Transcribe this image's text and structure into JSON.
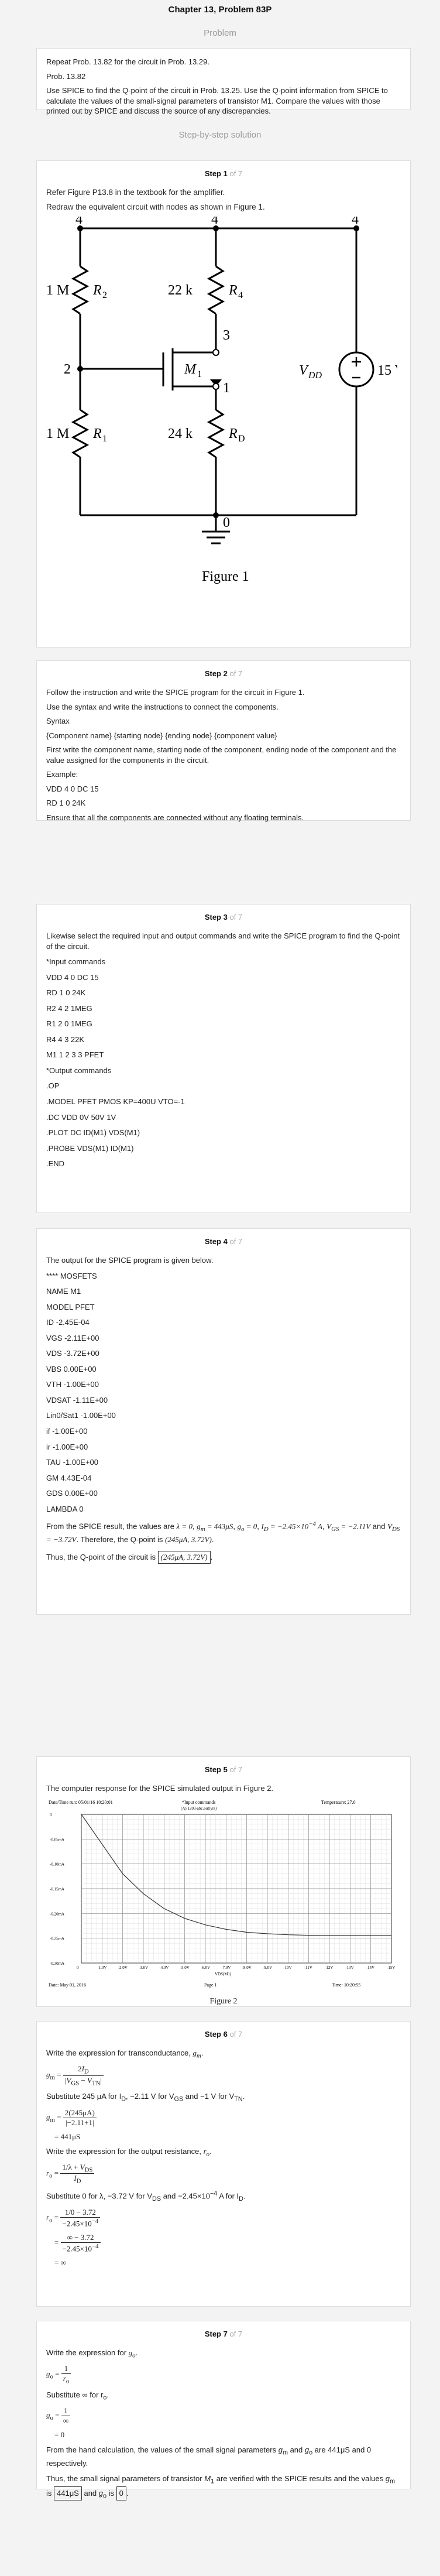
{
  "header": {
    "title": "Chapter 13, Problem 83P",
    "problem_label": "Problem",
    "solution_label": "Step-by-step solution"
  },
  "problem": {
    "lines": [
      "Repeat Prob. 13.82 for the circuit in Prob. 13.29.",
      "Prob. 13.82",
      "Use SPICE to find the Q-point of the circuit in Prob. 13.25. Use the Q-point information from SPICE to calculate the values of the small-signal parameters of transistor M1. Compare the values with those printed out by SPICE and discuss the source of any discrepancies."
    ]
  },
  "steps": {
    "s1": {
      "label": "Step 1",
      "of": "of 7",
      "lines": [
        "Refer Figure P13.8 in the textbook for the amplifier.",
        "Redraw the equivalent circuit with nodes as shown in Figure 1."
      ],
      "figure_caption": "Figure 1",
      "circuit": {
        "n4a": "4",
        "n4b": "4",
        "n4c": "4",
        "n2": "2",
        "n3": "3",
        "n1": "1",
        "n0": "0",
        "r2": "1 M",
        "r2n": "R",
        "r2s": "2",
        "r4": "22 k",
        "r4n": "R",
        "r4s": "4",
        "r1": "1 M",
        "r1n": "R",
        "r1s": "1",
        "rd": "24 k",
        "rdn": "R",
        "rds": "D",
        "m1": "M",
        "m1s": "1",
        "vdd": "V",
        "vdds": "DD",
        "vval": "15 V"
      }
    },
    "s2": {
      "label": "Step 2",
      "of": "of 7",
      "lines": [
        "Follow the instruction and write the SPICE program for the circuit in Figure 1.",
        "Use the syntax and write the instructions to connect the components.",
        "Syntax",
        "{Component name} {starting node} {ending node} {component value}",
        "First write the component name, starting node of the component, ending node of the component and the value assigned for the components in the circuit.",
        "Example:",
        "VDD 4 0 DC 15",
        "RD 1 0 24K",
        "Ensure that all the components are connected without any floating terminals."
      ]
    },
    "s3": {
      "label": "Step 3",
      "of": "of 7",
      "lines": [
        "Likewise select the required input and output commands and write the SPICE program to find the Q-point of the circuit.",
        "*Input commands",
        "VDD 4 0 DC 15",
        "RD 1 0 24K",
        "R2 4 2 1MEG",
        "R1 2 0 1MEG",
        "R4 4 3 22K",
        "M1 1 2 3 3 PFET",
        "*Output commands",
        ".OP",
        ".MODEL PFET PMOS KP=400U VTO=-1",
        ".DC VDD 0V 50V 1V",
        ".PLOT DC ID(M1) VDS(M1)",
        ".PROBE VDS(M1) ID(M1)",
        ".END"
      ]
    },
    "s4": {
      "label": "Step 4",
      "of": "of 7",
      "lines": [
        "The output for the SPICE program is given below.",
        "**** MOSFETS",
        "NAME M1",
        "MODEL PFET",
        "ID -2.45E-04",
        "VGS -2.11E+00",
        "VDS -3.72E+00",
        "VBS 0.00E+00",
        "VTH -1.00E+00",
        "VDSAT -1.11E+00",
        "Lin0/Sat1 -1.00E+00",
        "if -1.00E+00",
        "ir -1.00E+00",
        "TAU -1.00E+00",
        "GM 4.43E-04",
        "GDS 0.00E+00",
        "LAMBDA 0"
      ],
      "result_a": "From the SPICE result, the values are ",
      "result_b": ". Therefore, the Q-point is ",
      "lambda": "λ = 0",
      "gm": "g",
      "gm_val": " = 443μS",
      "go_val": " = 0",
      "id_val": " = −2.45×10",
      "id_exp": "−4",
      "id_unit": " A",
      "vgs_val": " = −2.11V",
      "vds_val": " = −3.72V",
      "qpoint": "(245μA, 3.72V)",
      "conclusion": "Thus, the Q-point of the circuit is ",
      "answer": "(245μA, 3.72V)"
    },
    "s5": {
      "label": "Step 5",
      "of": "of 7",
      "lines": [
        "The computer response for the SPICE simulated output in Figure 2."
      ],
      "figure_caption": "Figure 2",
      "plot_header_left": "Date/Time run: 05/01/16 10:20:01",
      "plot_header_mid": "*Input commands",
      "plot_header_right": "Temperature: 27.0",
      "plot_legend": "(A) 1203-abc.out(vrs)",
      "plot_footer_left": "Date: May 01, 2016",
      "plot_footer_mid": "Page 1",
      "plot_footer_right": "Time: 10:20:55",
      "plot_xlabel": "VDS(M1)"
    },
    "s6": {
      "label": "Step 6",
      "of": "of 7",
      "lines": [
        "Write the expression for transconductance, "
      ],
      "subst1": "Substitute 245 μA for I",
      "subst1b": ", −2.11 V for V",
      "subst1c": " and −1 V for V",
      "gm_result": "= 441μS",
      "ro_text": "Write the expression for the output resistance, ",
      "subst2": "Substitute 0 for λ, −3.72 V for V",
      "subst2b": " and −2.45×10",
      "subst2c": " A for I",
      "ro_result": "= ∞"
    },
    "s7": {
      "label": "Step 7",
      "of": "of 7",
      "lines": [
        "Write the expression for "
      ],
      "subst": "Substitute ∞ for r",
      "go_result": "= 0",
      "final_a": "From the hand calculation, the values of the small signal parameters ",
      "final_b": " and ",
      "final_c": " are 441μS and 0 respectively.",
      "final_d": "Thus, the small signal parameters of transistor ",
      "final_e": " are verified with the SPICE results and the values ",
      "final_f": " is ",
      "final_g": " and ",
      "final_h": " is ",
      "ans_gm": "441μS",
      "ans_go": "0"
    }
  },
  "chart_data": {
    "type": "line",
    "xlabel": "VDS(M1)",
    "x": [
      0,
      -1,
      -2,
      -3,
      -4,
      -5,
      -6,
      -7,
      -8,
      -9,
      -10,
      -11,
      -12,
      -13,
      -14,
      -15
    ],
    "series": [
      {
        "values": [
          0,
          0.06,
          0.12,
          0.16,
          0.19,
          0.21,
          0.223,
          0.232,
          0.238,
          0.241,
          0.243,
          0.244,
          0.245,
          0.245,
          0.245,
          0.245
        ]
      }
    ],
    "xlim": [
      -15,
      0
    ],
    "xticks": [
      "0",
      "-1.0V",
      "-2.0V",
      "-3.0V",
      "-4.0V",
      "-5.0V",
      "-6.0V",
      "-7.0V",
      "-8.0V",
      "-9.0V",
      "-10V",
      "-11V",
      "-12V",
      "-13V",
      "-14V",
      "-15V"
    ],
    "yticks": [
      "0",
      "-0.05mA",
      "-0.10mA",
      "-0.15mA",
      "-0.20mA",
      "-0.25mA",
      "-0.30mA"
    ],
    "grid": true
  }
}
